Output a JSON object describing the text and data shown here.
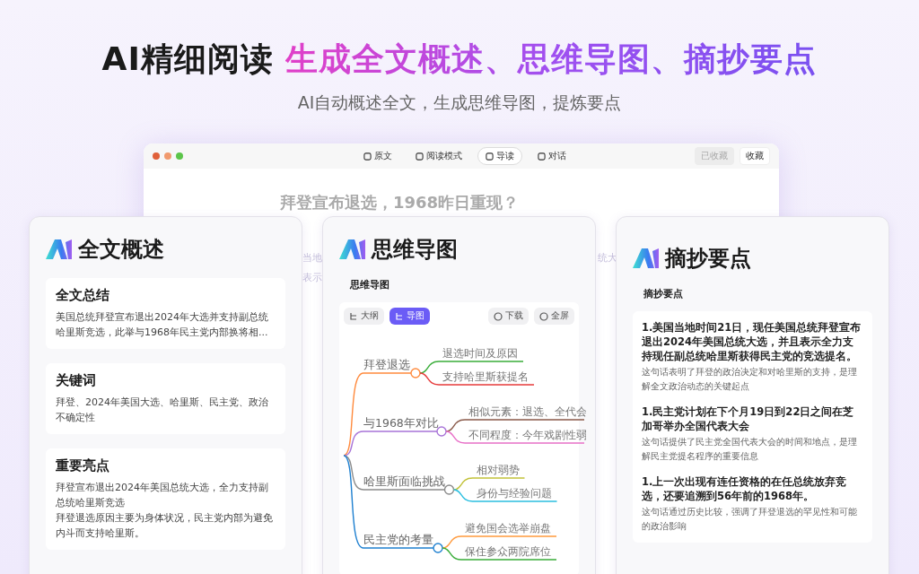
{
  "headline": {
    "plain": "AI精细阅读",
    "highlight": "生成全文概述、思维导图、摘抄要点"
  },
  "subtitle": "AI自动概述全文，生成思维导图，提炼要点",
  "window": {
    "tabs": [
      {
        "label": "原文",
        "selected": false
      },
      {
        "label": "阅读模式",
        "selected": false
      },
      {
        "label": "导读",
        "selected": true
      },
      {
        "label": "对话",
        "selected": false
      }
    ],
    "buttons": [
      {
        "label": "已收藏",
        "disabled": true
      },
      {
        "label": "收藏",
        "disabled": false
      }
    ],
    "article_title": "拜登宣布退选，1968昨日重现？",
    "article_fragments": [
      "当地",
      "表示",
      "统大"
    ]
  },
  "overview": {
    "title": "全文概述",
    "sections": [
      {
        "heading": "全文总结",
        "body": "美国总统拜登宣布退出2024年大选并支持副总统哈里斯竞选，此举与1968年民主党内部换将相..."
      },
      {
        "heading": "关键词",
        "body": "拜登、2024年美国大选、哈里斯、民主党、政治不确定性"
      },
      {
        "heading": "重要亮点",
        "lines": [
          "拜登宣布退出2024年美国总统大选，全力支持副总统哈里斯竞选",
          "拜登退选原因主要为身体状况，民主党内部为避免内斗而支持哈里斯。"
        ]
      }
    ]
  },
  "mindmap": {
    "title": "思维导图",
    "label": "思维导图",
    "views": [
      {
        "label": "大纲",
        "selected": false
      },
      {
        "label": "导图",
        "selected": true
      }
    ],
    "actions": [
      "下载",
      "全屏"
    ],
    "branches": [
      {
        "label": "拜登退选",
        "color": "#ff8a3d",
        "children": [
          {
            "label": "退选时间及原因",
            "color": "#3aad3a"
          },
          {
            "label": "支持哈里斯获提名",
            "color": "#e63b3b"
          }
        ]
      },
      {
        "label": "与1968年对比",
        "color": "#a874d8",
        "children": [
          {
            "label": "相似元素：退选、全代会",
            "color": "#8a5a4a"
          },
          {
            "label": "不同程度：今年戏剧性弱",
            "color": "#e870c8"
          }
        ]
      },
      {
        "label": "哈里斯面临挑战",
        "color": "#8c8c8c",
        "children": [
          {
            "label": "相对弱势",
            "color": "#c2c23a"
          },
          {
            "label": "身份与经验问题",
            "color": "#2cbfe0"
          }
        ]
      },
      {
        "label": "民主党的考量",
        "color": "#1f80d0",
        "children": [
          {
            "label": "避免国会选举崩盘",
            "color": "#ff9a3d"
          },
          {
            "label": "保住参众两院席位",
            "color": "#3aad3a"
          }
        ]
      }
    ]
  },
  "excerpts": {
    "title": "摘抄要点",
    "label": "摘抄要点",
    "items": [
      {
        "quote": "1.美国当地时间21日，现任美国总统拜登宣布退出2024年美国总统大选，并且表示全力支持现任副总统哈里斯获得民主党的竞选提名。",
        "note": "这句话表明了拜登的政治决定和对哈里斯的支持，是理解全文政治动态的关键起点"
      },
      {
        "quote": "1.民主党计划在下个月19日到22日之间在芝加哥举办全国代表大会",
        "note": "这句话提供了民主党全国代表大会的时间和地点，是理解民主党提名程序的重要信息"
      },
      {
        "quote": "1.上一次出现有连任资格的在任总统放弃竞选，还要追溯到56年前的1968年。",
        "note": "这句话通过历史比较，强调了拜登退选的罕见性和可能的政治影响"
      }
    ]
  }
}
